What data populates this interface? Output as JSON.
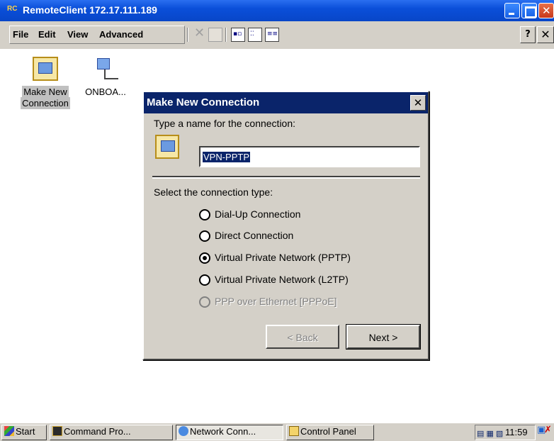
{
  "window": {
    "title": "RemoteClient 172.17.111.189",
    "app_icon": "RC"
  },
  "menu": {
    "file": "File",
    "edit": "Edit",
    "view": "View",
    "advanced": "Advanced",
    "help": "?",
    "close": "✕"
  },
  "desktop": {
    "icons": [
      {
        "label": "Make New Connection",
        "line1": "Make New",
        "line2": "Connection",
        "icon": "make-new-connection-icon"
      },
      {
        "label": "ONBOA...",
        "icon": "network-connection-icon"
      }
    ]
  },
  "dialog": {
    "title": "Make New Connection",
    "close": "✕",
    "name_prompt": "Type a name for the connection:",
    "name_value": "VPN-PPTP",
    "type_prompt": "Select the connection type:",
    "options": [
      {
        "label": "Dial-Up Connection",
        "checked": false,
        "enabled": true
      },
      {
        "label": "Direct Connection",
        "checked": false,
        "enabled": true
      },
      {
        "label": "Virtual Private Network (PPTP)",
        "checked": true,
        "enabled": true
      },
      {
        "label": "Virtual Private Network (L2TP)",
        "checked": false,
        "enabled": true
      },
      {
        "label": "PPP over Ethernet [PPPoE]",
        "checked": false,
        "enabled": false
      }
    ],
    "back": "< Back",
    "next": "Next >"
  },
  "taskbar": {
    "start": "Start",
    "tasks": [
      {
        "label": "Command Pro...",
        "icon": "command-prompt-icon"
      },
      {
        "label": "Network Conn...",
        "icon": "network-icon",
        "active": true
      },
      {
        "label": "Control Panel",
        "icon": "control-panel-icon"
      }
    ],
    "clock": "11:59"
  },
  "colors": {
    "titlebar": "#0a4fd9",
    "dialog_title": "#0a246a",
    "face": "#d4d0c8"
  }
}
